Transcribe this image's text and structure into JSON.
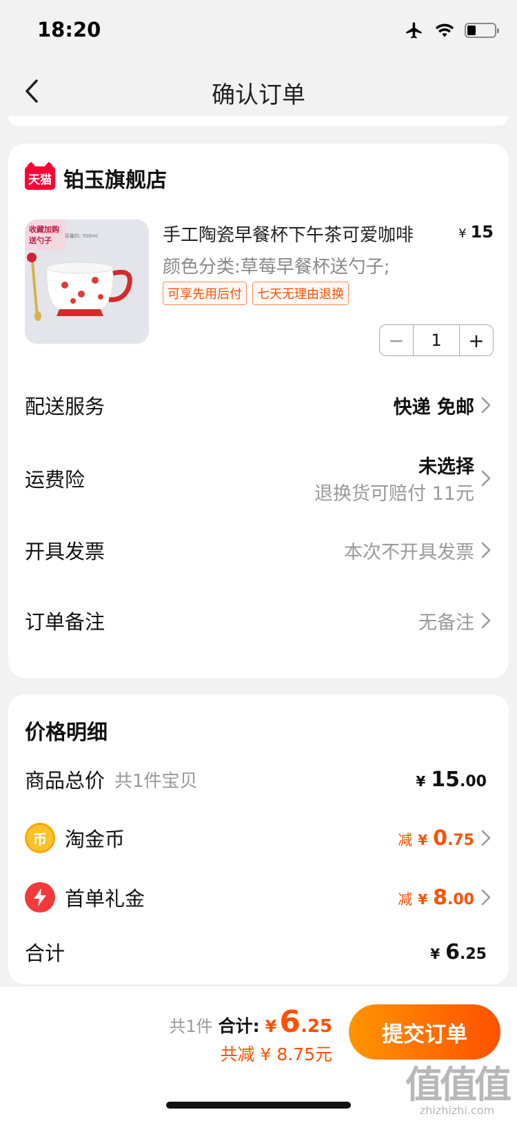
{
  "status_bar": {
    "time": "18:20"
  },
  "nav": {
    "title": "确认订单"
  },
  "store": {
    "badge": "天猫",
    "name": "铂玉旗舰店"
  },
  "product": {
    "title": "手工陶瓷早餐杯下午茶可爱咖啡",
    "price_currency": "¥",
    "price": "15",
    "variant": "颜色分类:草莓早餐杯送勺子;",
    "tags": [
      "可享先用后付",
      "七天无理由退换"
    ],
    "image_overlay_text": [
      "收藏加购",
      "送勺子"
    ],
    "image_capacity": "容量约: 500ml",
    "quantity": "1",
    "decrement_label": "−",
    "increment_label": "+"
  },
  "options": {
    "delivery": {
      "label": "配送服务",
      "value": "快递 免邮"
    },
    "shipping_insurance": {
      "label": "运费险",
      "value": "未选择",
      "sub": "退换货可赔付 11元"
    },
    "invoice": {
      "label": "开具发票",
      "value": "本次不开具发票"
    },
    "note": {
      "label": "订单备注",
      "value": "无备注"
    }
  },
  "price_detail": {
    "title": "价格明细",
    "goods_total": {
      "label": "商品总价",
      "sub": "共1件宝贝",
      "currency": "¥",
      "int": "15",
      "dec": ".00"
    },
    "taojinbi": {
      "label": "淘金币",
      "prefix": "减",
      "currency": "¥",
      "int": "0",
      "dec": ".75",
      "icon_glyph": "币"
    },
    "first_order_gift": {
      "label": "首单礼金",
      "prefix": "减",
      "currency": "¥",
      "int": "8",
      "dec": ".00"
    },
    "total": {
      "label": "合计",
      "currency": "¥",
      "int": "6",
      "dec": ".25"
    }
  },
  "bottom_bar": {
    "count": "共1件",
    "total_label": "合计:",
    "currency": "¥",
    "total_int": "6",
    "total_dec": ".25",
    "discount_text": "共减 ¥ 8.75元",
    "submit_label": "提交订单"
  },
  "watermark": {
    "mark": "值值值",
    "url": "zhizhizhi.com"
  },
  "colors": {
    "accent": "#ff5000",
    "tmall_red": "#ff0036",
    "coin_gold": "#fdc12a",
    "gift_red": "#f33a3a"
  }
}
